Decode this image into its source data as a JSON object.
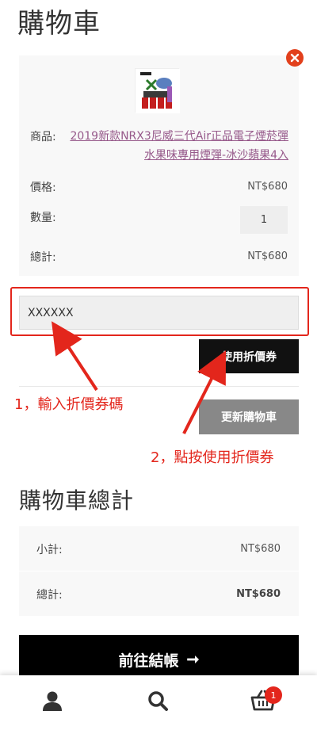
{
  "page": {
    "title": "購物車"
  },
  "cart_item": {
    "product_label": "商品:",
    "product_name": "2019新款NRX3尼威三代Air正品電子煙菸彈水果味專用煙彈-冰沙蘋果4入",
    "price_label": "價格:",
    "price_value": "NT$680",
    "quantity_label": "數量:",
    "quantity_value": "1",
    "total_label": "總計:",
    "total_value": "NT$680"
  },
  "coupon": {
    "code_value": "XXXXXX",
    "apply_label": "使用折價券"
  },
  "update_cart_label": "更新購物車",
  "annotations": {
    "step1": "1，輸入折價券碼",
    "step2": "2，點按使用折價券"
  },
  "cart_totals": {
    "title": "購物車總計",
    "subtotal_label": "小計:",
    "subtotal_value": "NT$680",
    "total_label": "總計:",
    "total_value": "NT$680"
  },
  "checkout": {
    "label": "前往結帳",
    "arrow": "➞"
  },
  "bottom_nav": {
    "cart_count": "1",
    "icons": [
      "account-icon",
      "search-icon",
      "cart-icon"
    ]
  },
  "colors": {
    "accent_red": "#e3261c",
    "link_purple": "#96588a",
    "button_dark": "#111111",
    "button_gray": "#888888"
  }
}
